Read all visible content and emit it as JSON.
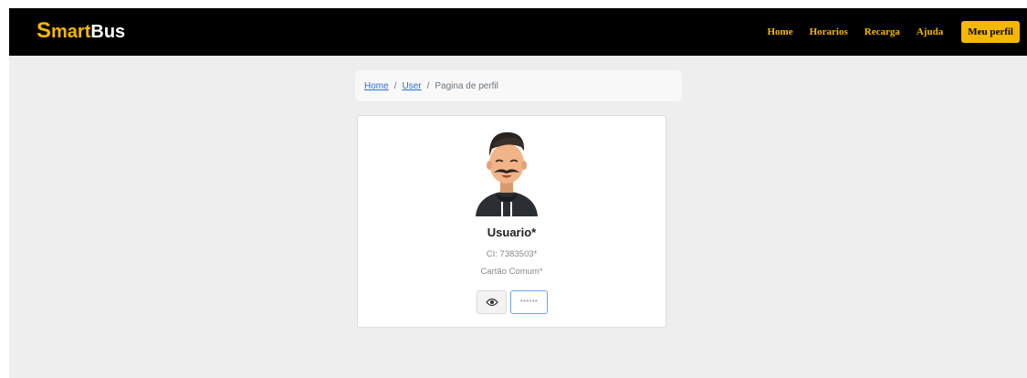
{
  "brand": {
    "s": "S",
    "mart": "mart",
    "bus": "Bus"
  },
  "nav": {
    "items": [
      {
        "label": "Home"
      },
      {
        "label": "Horarios"
      },
      {
        "label": "Recarga"
      },
      {
        "label": "Ajuda"
      }
    ],
    "profile_button": "Meu perfil"
  },
  "breadcrumb": {
    "home": "Home",
    "user": "User",
    "current": "Pagina de perfil",
    "separator": "/"
  },
  "profile": {
    "name": "Usuario*",
    "ci": "CI: 7383503*",
    "card_type": "Cartão Comum*",
    "password_mask": "******"
  },
  "icons": {
    "show_password": "eye-icon",
    "avatar": "user-avatar"
  },
  "colors": {
    "accent": "#f5b800",
    "navbar_bg": "#000000",
    "link": "#2a6fd6",
    "field_border": "#6aa5e8"
  }
}
